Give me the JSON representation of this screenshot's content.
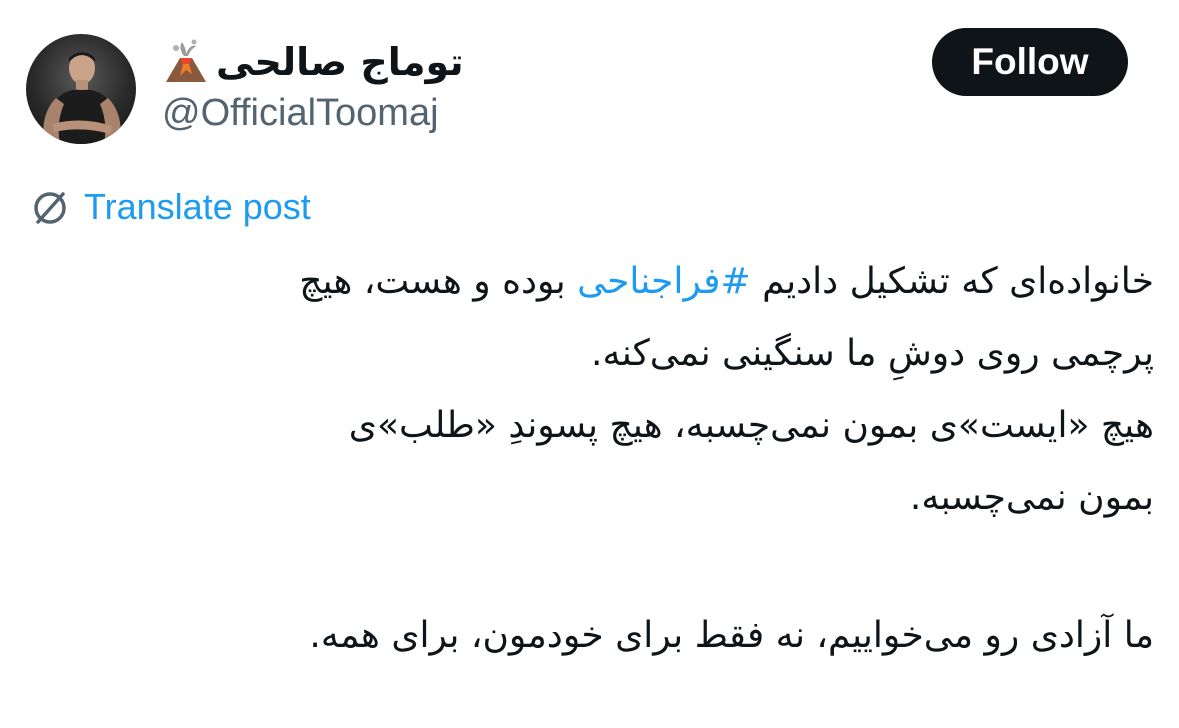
{
  "author": {
    "display_name": "توماج صالحی",
    "name_emoji": "volcano-icon",
    "handle": "@OfficialToomaj",
    "avatar": "avatar"
  },
  "follow_button": {
    "label": "Follow"
  },
  "translate": {
    "label": "Translate post",
    "icon": "translate-icon"
  },
  "post": {
    "line1_before": "خانواده‌ای که تشکیل دادیم",
    "hashtag": "#فراجناحی",
    "line1_after": "بوده و هست، هیچ",
    "line2": "پرچمی روی دوشِ ما سنگینی نمی‌کنه.",
    "line3": "هیچ «ایست»ی بمون نمی‌چسبه، هیچ پسوندِ «طلب»ی",
    "line4": "بمون نمی‌چسبه.",
    "line5": "ما آزادی رو می‌خواییم، نه فقط برای خودمون، برای همه."
  },
  "colors": {
    "link": "#1d9bf0",
    "text": "#0f1419",
    "secondary": "#536471",
    "button_bg": "#0f1419",
    "button_text": "#ffffff"
  }
}
